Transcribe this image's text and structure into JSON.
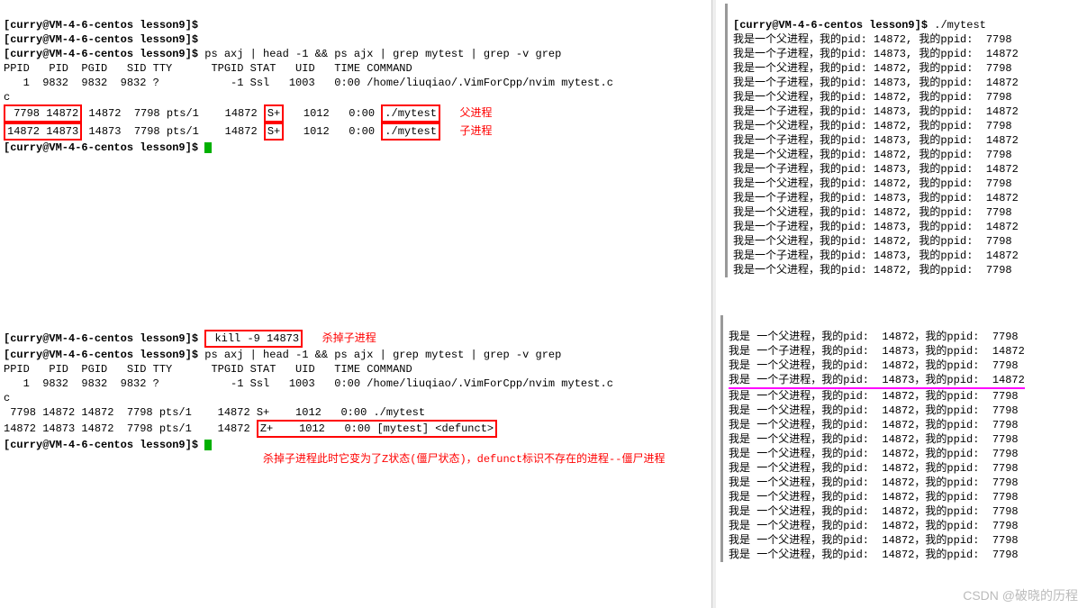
{
  "prompt1": "[curry@VM-4-6-centos lesson9]$",
  "cmd_run": " ./mytest",
  "cmd_ps": " ps axj | head -1 && ps ajx | grep mytest | grep -v grep",
  "cmd_kill": " kill -9 14873",
  "kill_label": "杀掉子进程",
  "ps_header": "PPID   PID  PGID   SID TTY      TPGID STAT   UID   TIME COMMAND",
  "ps_row_nvim": "   1  9832  9832  9832 ?           -1 Ssl   1003   0:00 /home/liuqiao/.VimForCpp/nvim mytest.c",
  "ps_row_c": "c",
  "parent_label": "父进程",
  "child_label": "子进程",
  "row_p1_a": " 7798 14872",
  "row_p1_b": " 14872  7798 pts/1    14872 ",
  "row_p1_stat": "S+",
  "row_p1_c": "   1012   0:00 ",
  "row_p1_cmd": "./mytest",
  "row_c1_a": "14872 14873",
  "row_c1_b": " 14873  7798 pts/1    14872 ",
  "row_c1_stat": "S+",
  "row_c1_c": "   1012   0:00 ",
  "row_c1_cmd": "./mytest",
  "row_p2": " 7798 14872 14872  7798 pts/1    14872 S+    1012   0:00 ./mytest",
  "row_c2_a": "14872 14873 14872  7798 pts/1    14872 ",
  "row_c2_stat": "Z+    1012   0:00 [mytest] <defunct>",
  "zombie_note": "杀掉子进程此时它变为了Z状态(僵尸状态)，defunct标识不存在的进程--僵尸进程",
  "out_parent": "我是一个父进程，我的pid: 14872, 我的ppid:  7798",
  "out_child": "我是一个子进程，我的pid: 14873, 我的ppid:  14872",
  "out_p_only": "我是 一个父进程，我的pid:  14872，我的ppid:  7798",
  "out_c_alt": "我是 一个子进程，我的pid:  14873，我的ppid:  14872",
  "out_p_alt": "我是 一个父进程，我的pid:  14872，我的ppid:  7798",
  "watermark": "CSDN @破晓的历程"
}
